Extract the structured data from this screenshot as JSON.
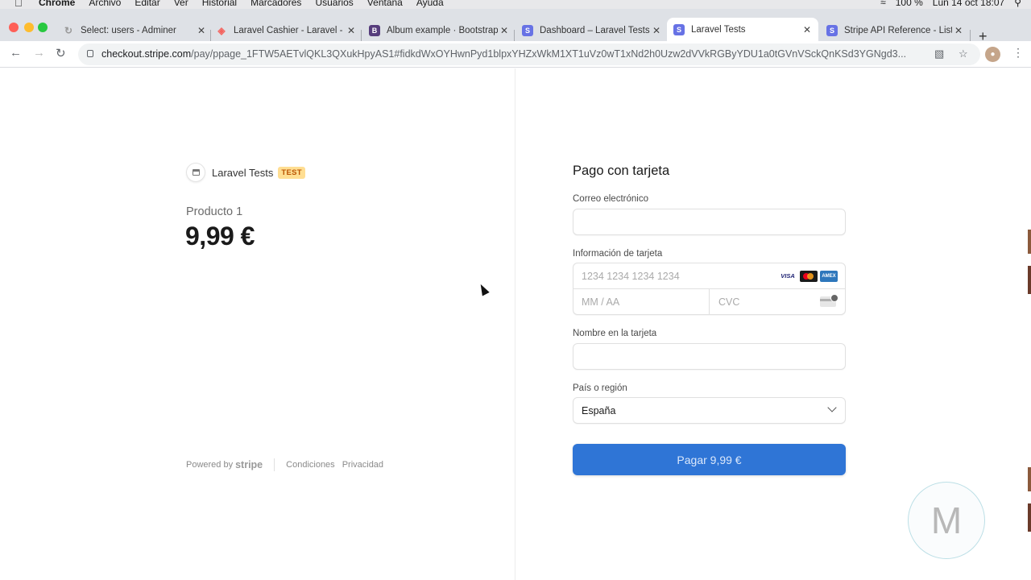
{
  "menubar": {
    "app": "Chrome",
    "items": [
      "Archivo",
      "Editar",
      "Ver",
      "Historial",
      "Marcadores",
      "Usuarios",
      "Ventana",
      "Ayuda"
    ],
    "battery": "100 %",
    "clock": "Lun 14 oct  18:07"
  },
  "tabs": [
    {
      "title": "Select: users - Adminer",
      "icon": "adminer-icon",
      "active": false
    },
    {
      "title": "Laravel Cashier - Laravel -",
      "icon": "laravel-icon",
      "active": false
    },
    {
      "title": "Album example · Bootstrap",
      "icon": "bootstrap-icon",
      "active": false
    },
    {
      "title": "Dashboard – Laravel Tests",
      "icon": "stripe-icon",
      "active": false
    },
    {
      "title": "Laravel Tests",
      "icon": "stripe-icon",
      "active": true
    },
    {
      "title": "Stripe API Reference - List",
      "icon": "stripe-icon",
      "active": false
    }
  ],
  "address": {
    "host": "checkout.stripe.com",
    "path": "/pay/ppage_1FTW5AETvlQKL3QXukHpyAS1#fidkdWxOYHwnPyd1blpxYHZxWkM1XT1uVz0wT1xNd2h0Uzw2dVVkRGByYDU1a0tGVnVSckQnKSd3YGNgd3..."
  },
  "merchant": {
    "name": "Laravel Tests",
    "badge": "TEST"
  },
  "product": {
    "name": "Producto 1",
    "price": "9,99 €"
  },
  "footer": {
    "powered": "Powered by",
    "brand": "stripe",
    "terms": "Condiciones",
    "privacy": "Privacidad"
  },
  "form": {
    "title": "Pago con tarjeta",
    "email_label": "Correo electrónico",
    "email_value": "",
    "card_label": "Información de tarjeta",
    "card_number_placeholder": "1234 1234 1234 1234",
    "expiry_placeholder": "MM / AA",
    "cvc_placeholder": "CVC",
    "visa": "VISA",
    "amex": "AMEX",
    "name_label": "Nombre en la tarjeta",
    "name_value": "",
    "country_label": "País o región",
    "country_value": "España",
    "pay_button": "Pagar 9,99 €"
  },
  "watermark": "M",
  "colors": {
    "pay_button": "#2f75d6",
    "test_badge_bg": "#ffde92",
    "test_badge_text": "#bb5504"
  }
}
